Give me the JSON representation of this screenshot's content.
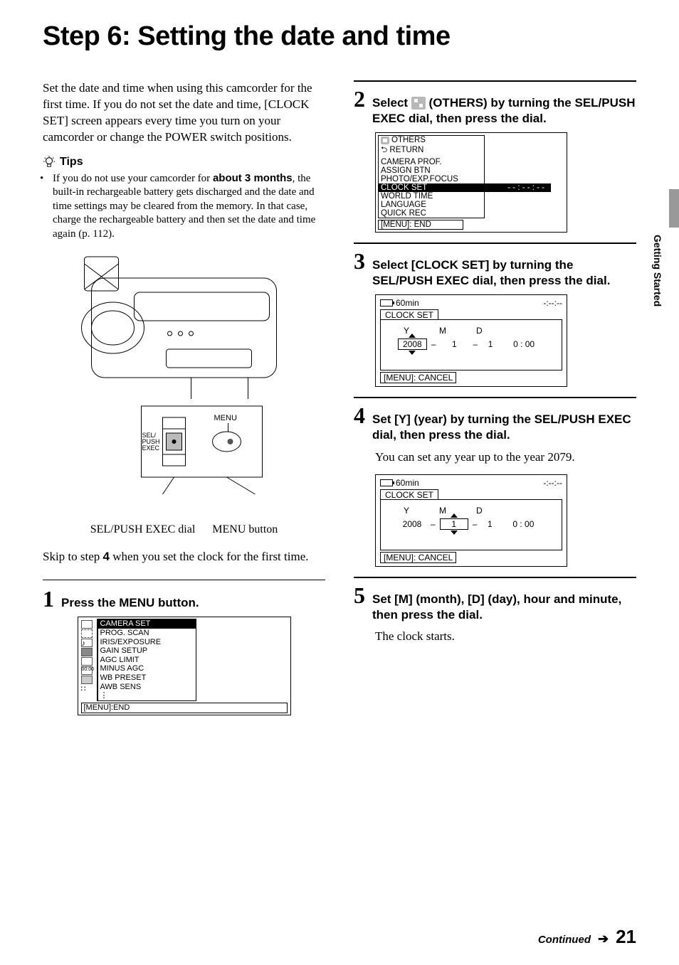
{
  "title": "Step 6: Setting the date and time",
  "side_tab": "Getting Started",
  "intro": "Set the date and time when using this camcorder for the first time. If you do not set the date and time, [CLOCK SET] screen appears every time you turn on your camcorder or change the POWER switch positions.",
  "tips": {
    "label": "Tips",
    "body_prefix": "If you do not use your camcorder for ",
    "body_bold": "about 3 months",
    "body_suffix": ", the built-in rechargeable battery gets discharged and the date and time settings may be cleared from the memory. In that case, charge the rechargeable battery and then set the date and time again (p. 112)."
  },
  "camcorder": {
    "dial_label": "SEL/\nPUSH\nEXEC",
    "menu_label": "MENU",
    "caption_dial": "SEL/PUSH EXEC dial",
    "caption_menu": "MENU button"
  },
  "skip_text_a": "Skip to step ",
  "skip_text_bold": "4",
  "skip_text_b": " when you set the clock for the first time.",
  "step1": {
    "num": "1",
    "title": "Press the MENU button.",
    "menu": {
      "header": "CAMERA SET",
      "items": [
        "PROG. SCAN",
        "IRIS/EXPOSURE",
        "GAIN SETUP",
        "AGC LIMIT",
        "MINUS AGC",
        "WB PRESET",
        "AWB SENS"
      ],
      "footer": "[MENU]:END"
    }
  },
  "step2": {
    "num": "2",
    "title_a": "Select ",
    "title_b": " (OTHERS) by turning the SEL/PUSH EXEC dial, then press the dial.",
    "others_icon_name": "others-icon",
    "menu": {
      "header": "OTHERS",
      "items": [
        "RETURN",
        "CAMERA PROF.",
        "ASSIGN BTN",
        "PHOTO/EXP.FOCUS",
        "CLOCK SET",
        "WORLD TIME",
        "LANGUAGE",
        "QUICK REC"
      ],
      "highlighted_index": 4,
      "highlighted_value": "- - : - - : - -",
      "footer": "[MENU]: END"
    }
  },
  "step3": {
    "num": "3",
    "title": "Select [CLOCK SET] by turning the SEL/PUSH EXEC dial, then press the dial.",
    "clock": {
      "batt": "60min",
      "timecode": "-:--:--",
      "title": "CLOCK  SET",
      "labels": {
        "y": "Y",
        "m": "M",
        "d": "D"
      },
      "y": "2008",
      "m": "1",
      "d": "1",
      "time": "0 : 00",
      "active": "y",
      "footer": "[MENU]: CANCEL"
    }
  },
  "step4": {
    "num": "4",
    "title": "Set [Y] (year) by turning the SEL/PUSH EXEC dial, then press the dial.",
    "body": "You can set any year up to the year 2079.",
    "clock": {
      "batt": "60min",
      "timecode": "-:--:--",
      "title": "CLOCK  SET",
      "labels": {
        "y": "Y",
        "m": "M",
        "d": "D"
      },
      "y": "2008",
      "m": "1",
      "d": "1",
      "time": "0 : 00",
      "active": "m",
      "footer": "[MENU]: CANCEL"
    }
  },
  "step5": {
    "num": "5",
    "title": "Set [M] (month), [D] (day), hour and minute, then press the dial.",
    "body": "The clock starts."
  },
  "footer": {
    "continued": "Continued",
    "page": "21"
  }
}
